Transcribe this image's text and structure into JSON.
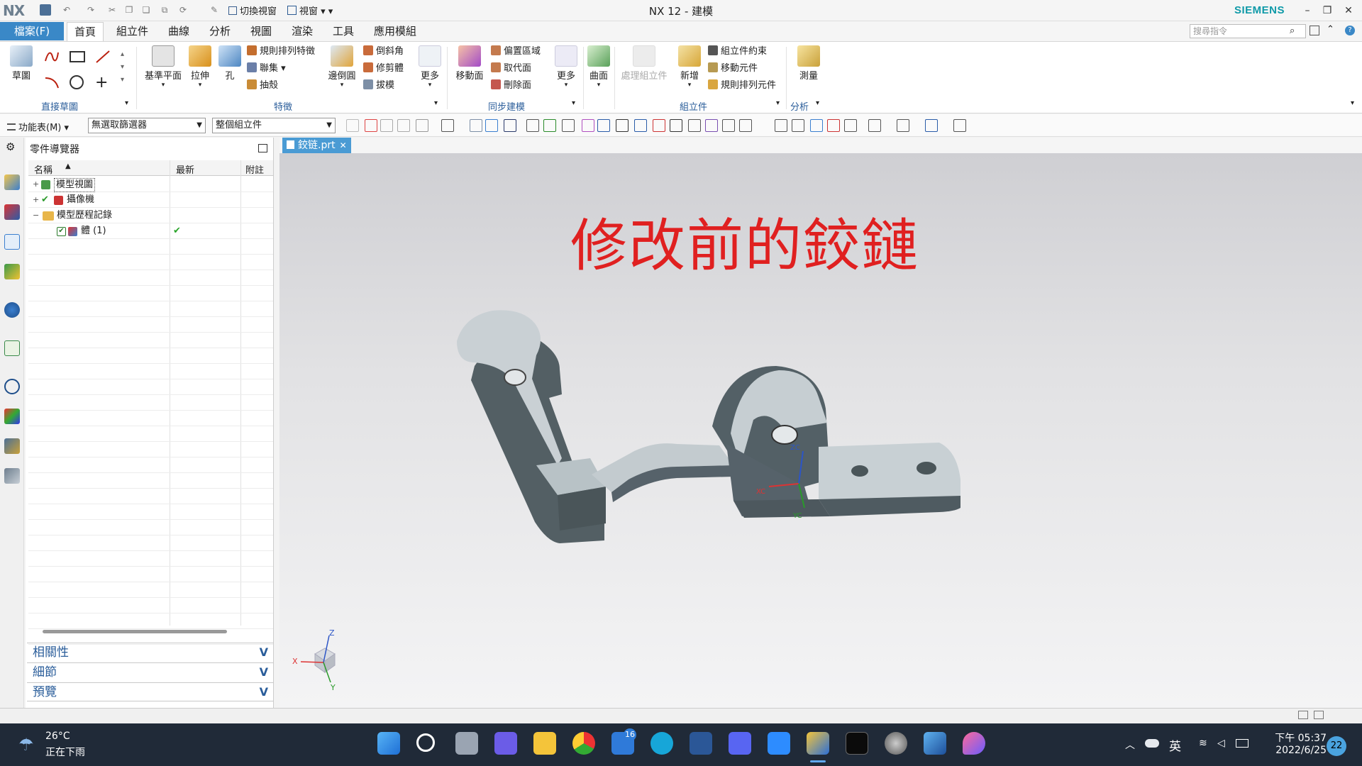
{
  "titlebar": {
    "logo": "NX",
    "switch_window": "切換視窗",
    "view": "視窗",
    "title": "NX 12 - 建模",
    "brand": "SIEMENS"
  },
  "menu": {
    "file": "檔案(F)",
    "tabs": [
      "首頁",
      "組立件",
      "曲線",
      "分析",
      "視圖",
      "渲染",
      "工具",
      "應用模組"
    ],
    "active_tab": "首頁",
    "search_placeholder": "搜尋指令"
  },
  "ribbon": {
    "sketch": "草圖",
    "direct_sketch_group": "直接草圖",
    "datum_plane": "基準平面",
    "extrude": "拉伸",
    "hole": "孔",
    "pattern_feature": "規則排列特徵",
    "unite": "聯集",
    "shell": "抽殼",
    "edge_blend": "邊倒圓",
    "chamfer": "倒斜角",
    "trim_body": "修剪體",
    "draft": "拔模",
    "more1": "更多",
    "feature_group": "特徵",
    "move_face": "移動面",
    "offset_region": "偏置區域",
    "replace_face": "取代面",
    "delete_face": "刪除面",
    "more2": "更多",
    "sync_group": "同步建模",
    "surface": "曲面",
    "assembly_btn": "處理組立件",
    "new": "新增",
    "assembly_constraints": "組立件約束",
    "move_component": "移動元件",
    "pattern_component": "規則排列元件",
    "assembly_group": "組立件",
    "measure": "測量",
    "analysis_group": "分析"
  },
  "toolbar": {
    "menu": "功能表(M)",
    "filter": "無選取篩選器",
    "scope": "整個組立件"
  },
  "navigator": {
    "title": "零件導覽器",
    "columns": [
      "名稱",
      "最新",
      "附註"
    ],
    "rows": [
      {
        "label": "模型視圖",
        "expander": "+",
        "uptodate": ""
      },
      {
        "label": "攝像機",
        "expander": "+",
        "uptodate": ""
      },
      {
        "label": "模型歷程記錄",
        "expander": "−",
        "uptodate": ""
      },
      {
        "label": "體 (1)",
        "expander": "",
        "uptodate": "✔"
      }
    ],
    "panels": [
      "相關性",
      "細節",
      "預覽"
    ]
  },
  "viewport": {
    "tab": "鉸链.prt",
    "annotation": "修改前的鉸鏈",
    "axis_labels": {
      "x": "X",
      "y": "Y",
      "z": "Z",
      "xc": "XC",
      "yc": "YC",
      "zc": "ZC"
    }
  },
  "taskbar": {
    "temperature": "26°C",
    "weather": "正在下雨",
    "mail_badge": "16",
    "ime": "英",
    "time": "下午 05:37",
    "date": "2022/6/25",
    "notifications": "22"
  },
  "colors": {
    "accent": "#3a88c7",
    "annotation": "#e02020",
    "model": "#4f5d62",
    "taskbar": "#202a38"
  }
}
